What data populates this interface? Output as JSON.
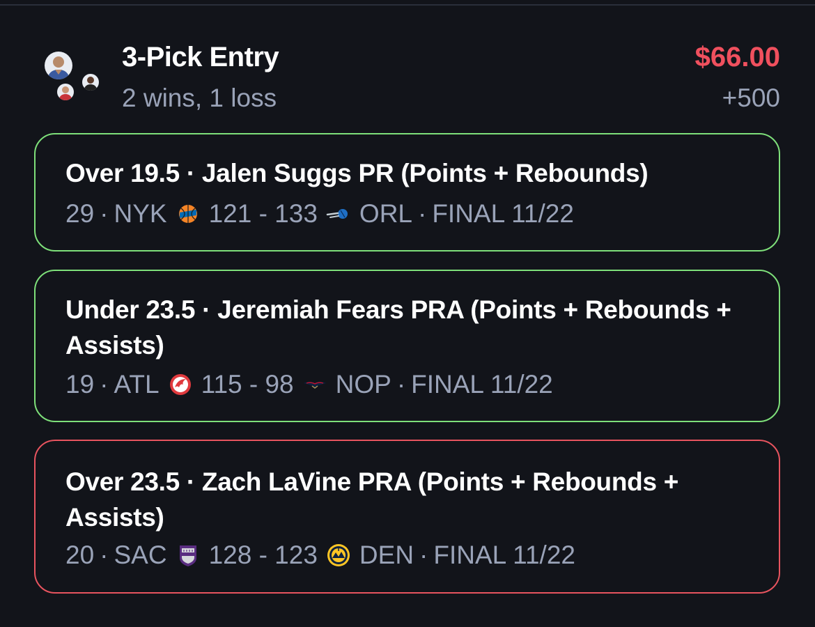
{
  "entry": {
    "title": "3-Pick Entry",
    "record": "2 wins, 1 loss",
    "payout": "$66.00",
    "odds": "+500",
    "payout_color": "#f0505e"
  },
  "picks": [
    {
      "result": "win",
      "border_color": "#7ee07a",
      "line": "Over 19.5 · Jalen Suggs PR (Points + Rebounds)",
      "stat": "29",
      "home_team": "NYK",
      "home_logo": "knicks-logo-icon",
      "score": "121 - 133",
      "away_logo": "magic-logo-icon",
      "away_team": "ORL",
      "status": "FINAL 11/22"
    },
    {
      "result": "win",
      "border_color": "#7ee07a",
      "line": "Under 23.5 · Jeremiah Fears PRA (Points + Rebounds + Assists)",
      "stat": "19",
      "home_team": "ATL",
      "home_logo": "hawks-logo-icon",
      "score": "115 - 98",
      "away_logo": "pelicans-logo-icon",
      "away_team": "NOP",
      "status": "FINAL 11/22"
    },
    {
      "result": "loss",
      "border_color": "#e8545f",
      "line": "Over 23.5 · Zach LaVine PRA (Points + Rebounds + Assists)",
      "stat": "20",
      "home_team": "SAC",
      "home_logo": "kings-logo-icon",
      "score": "128 - 123",
      "away_logo": "nuggets-logo-icon",
      "away_team": "DEN",
      "status": "FINAL 11/22"
    }
  ]
}
